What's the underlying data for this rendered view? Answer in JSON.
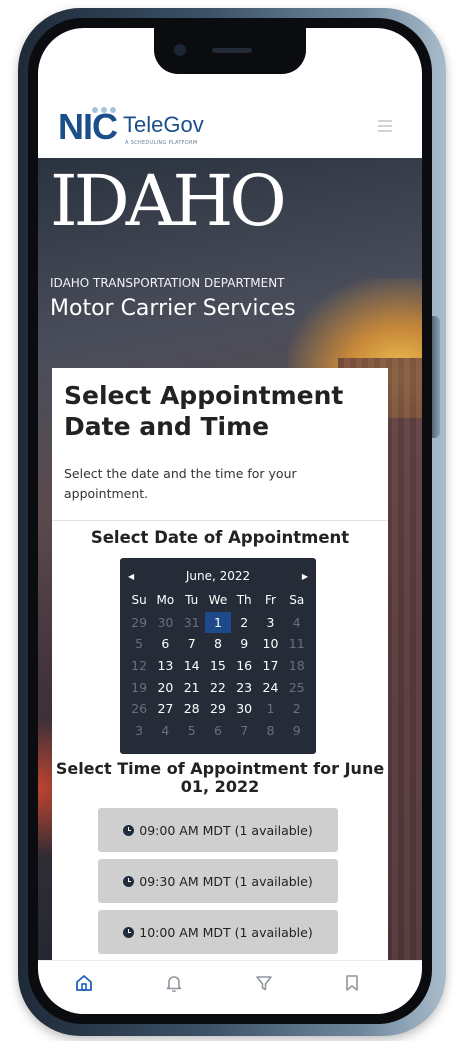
{
  "header": {
    "logo_nic": "NIC",
    "logo_telegov": "TeleGov",
    "logo_tagline": "A SCHEDULING PLATFORM",
    "menu_icon": "hamburger-icon"
  },
  "hero": {
    "state": "IDAHO",
    "department": "IDAHO TRANSPORTATION DEPARTMENT",
    "service": "Motor Carrier Services"
  },
  "page": {
    "title": "Select Appointment Date and Time",
    "description": "Select the date and the time for your appointment."
  },
  "date_section": {
    "heading": "Select Date of Appointment"
  },
  "calendar": {
    "month_label": "June, 2022",
    "prev_icon": "triangle-left-icon",
    "next_icon": "triangle-right-icon",
    "weekdays": [
      "Su",
      "Mo",
      "Tu",
      "We",
      "Th",
      "Fr",
      "Sa"
    ],
    "weeks": [
      [
        {
          "d": "29",
          "muted": true
        },
        {
          "d": "30",
          "muted": true
        },
        {
          "d": "31",
          "muted": true
        },
        {
          "d": "1",
          "selected": true
        },
        {
          "d": "2"
        },
        {
          "d": "3"
        },
        {
          "d": "4",
          "muted": true
        }
      ],
      [
        {
          "d": "5",
          "muted": true
        },
        {
          "d": "6"
        },
        {
          "d": "7"
        },
        {
          "d": "8"
        },
        {
          "d": "9"
        },
        {
          "d": "10"
        },
        {
          "d": "11",
          "muted": true
        }
      ],
      [
        {
          "d": "12",
          "muted": true
        },
        {
          "d": "13"
        },
        {
          "d": "14"
        },
        {
          "d": "15"
        },
        {
          "d": "16"
        },
        {
          "d": "17"
        },
        {
          "d": "18",
          "muted": true
        }
      ],
      [
        {
          "d": "19",
          "muted": true
        },
        {
          "d": "20"
        },
        {
          "d": "21"
        },
        {
          "d": "22"
        },
        {
          "d": "23"
        },
        {
          "d": "24"
        },
        {
          "d": "25",
          "muted": true
        }
      ],
      [
        {
          "d": "26",
          "muted": true
        },
        {
          "d": "27"
        },
        {
          "d": "28"
        },
        {
          "d": "29"
        },
        {
          "d": "30"
        },
        {
          "d": "1",
          "muted": true
        },
        {
          "d": "2",
          "muted": true
        }
      ],
      [
        {
          "d": "3",
          "muted": true
        },
        {
          "d": "4",
          "muted": true
        },
        {
          "d": "5",
          "muted": true
        },
        {
          "d": "6",
          "muted": true
        },
        {
          "d": "7",
          "muted": true
        },
        {
          "d": "8",
          "muted": true
        },
        {
          "d": "9",
          "muted": true
        }
      ]
    ]
  },
  "time_section": {
    "heading": "Select Time of Appointment for June 01, 2022",
    "slots": [
      {
        "label": "09:00 AM MDT (1 available)",
        "icon": "clock-icon"
      },
      {
        "label": "09:30 AM MDT (1 available)",
        "icon": "clock-icon"
      },
      {
        "label": "10:00 AM MDT (1 available)",
        "icon": "clock-icon"
      }
    ]
  },
  "bottom_nav": {
    "items": [
      {
        "icon": "home-icon",
        "active": true
      },
      {
        "icon": "bell-icon",
        "active": false
      },
      {
        "icon": "filter-icon",
        "active": false
      },
      {
        "icon": "bookmark-icon",
        "active": false
      }
    ]
  },
  "colors": {
    "brand_blue": "#1b4f8a",
    "calendar_bg": "#252c38",
    "selected_day": "#1e4a8a",
    "slot_bg": "#cfcfcf",
    "nav_active": "#1f5fbf",
    "nav_inactive": "#8e96a0"
  }
}
